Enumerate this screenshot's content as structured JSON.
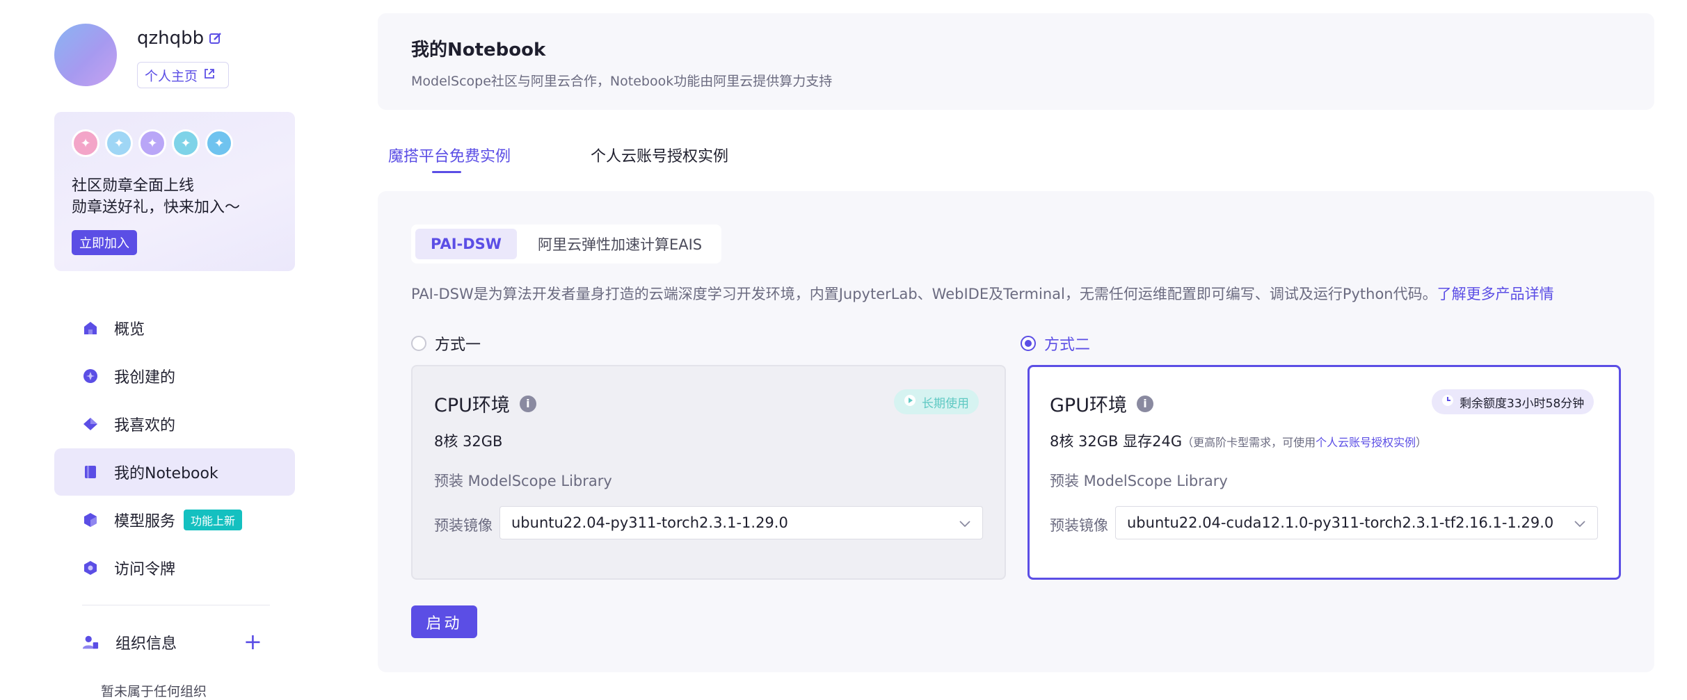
{
  "user": {
    "name": "qzhqbb",
    "homepage_label": "个人主页"
  },
  "badge_card": {
    "line1": "社区勋章全面上线",
    "line2": "勋章送好礼，快来加入～",
    "join_label": "立即加入",
    "medal_colors": [
      "#f3a5c8",
      "#9fd6f5",
      "#b9a6f7",
      "#7ed3e8",
      "#6fc3ef"
    ]
  },
  "nav": {
    "items": [
      {
        "label": "概览",
        "icon": "home-icon"
      },
      {
        "label": "我创建的",
        "icon": "create-icon"
      },
      {
        "label": "我喜欢的",
        "icon": "diamond-icon"
      },
      {
        "label": "我的Notebook",
        "icon": "notebook-icon"
      },
      {
        "label": "模型服务",
        "icon": "cube-icon",
        "tag": "功能上新"
      },
      {
        "label": "访问令牌",
        "icon": "shield-icon"
      }
    ],
    "org_title": "组织信息",
    "org_empty": "暂未属于任何组织"
  },
  "header": {
    "title": "我的Notebook",
    "subtitle": "ModelScope社区与阿里云合作，Notebook功能由阿里云提供算力支持"
  },
  "tabs": [
    {
      "label": "魔搭平台免费实例"
    },
    {
      "label": "个人云账号授权实例"
    }
  ],
  "segments": [
    {
      "label": "PAI-DSW"
    },
    {
      "label": "阿里云弹性加速计算EAIS"
    }
  ],
  "description": {
    "text": "PAI-DSW是为算法开发者量身打造的云端深度学习开发环境，内置JupyterLab、WebIDE及Terminal，无需任何运维配置即可编写、调试及运行Python代码。",
    "link": "了解更多产品详情"
  },
  "options": {
    "option1": "方式一",
    "option2": "方式二"
  },
  "cpu": {
    "title": "CPU环境",
    "pill": "长期使用",
    "spec": "8核 32GB",
    "lib": "预装 ModelScope Library",
    "image_label": "预装镜像",
    "image_value": "ubuntu22.04-py311-torch2.3.1-1.29.0"
  },
  "gpu": {
    "title": "GPU环境",
    "pill": "剩余额度33小时58分钟",
    "spec": "8核 32GB 显存24G",
    "spec_note_prefix": "（更高阶卡型需求，可使用",
    "spec_note_link": "个人云账号授权实例",
    "spec_note_suffix": "）",
    "lib": "预装 ModelScope Library",
    "image_label": "预装镜像",
    "image_value": "ubuntu22.04-cuda12.1.0-py311-torch2.3.1-tf2.16.1-1.29.0"
  },
  "start_label": "启动",
  "colors": {
    "accent": "#5b4ee5",
    "card_bg": "#f7f7fb",
    "teal": "#14c0c0"
  }
}
